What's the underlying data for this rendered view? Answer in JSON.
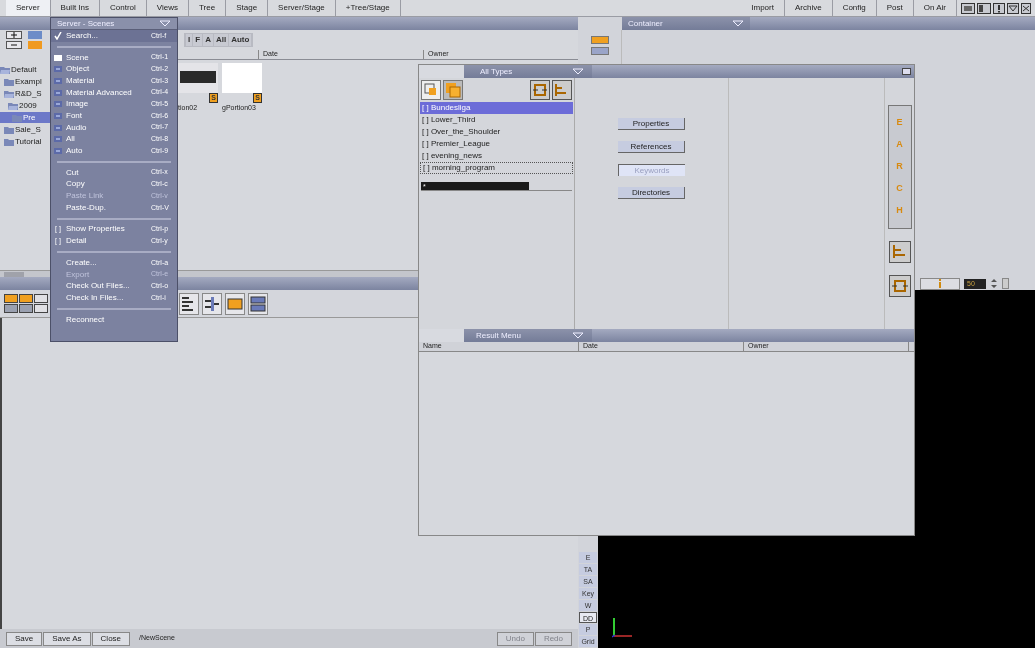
{
  "menubar": {
    "left": [
      {
        "label": "Server",
        "selected": true
      },
      {
        "label": "Built Ins",
        "selected": false
      },
      {
        "label": "Control",
        "selected": false
      },
      {
        "label": "Views",
        "selected": false
      },
      {
        "label": "Tree",
        "selected": false
      },
      {
        "label": "Stage",
        "selected": false
      },
      {
        "label": "Server/Stage",
        "selected": false
      },
      {
        "label": "+Tree/Stage",
        "selected": false
      }
    ],
    "right": [
      {
        "label": "Import",
        "selected": false
      },
      {
        "label": "Archive",
        "selected": false
      },
      {
        "label": "Config",
        "selected": false
      },
      {
        "label": "Post",
        "selected": false
      },
      {
        "label": "On Air",
        "selected": false
      }
    ]
  },
  "scene_pool": {
    "filters": [
      "I",
      "F",
      "A",
      "All",
      "Auto"
    ],
    "columns": [
      "Date",
      "Owner"
    ],
    "tree": [
      {
        "label": "Default",
        "expanded": true,
        "selected": false,
        "children": [
          {
            "label": "Exampl",
            "expanded": false,
            "selected": false
          },
          {
            "label": "R&D_S",
            "expanded": true,
            "selected": false,
            "children": [
              {
                "label": "2009",
                "expanded": true,
                "selected": false,
                "children": [
                  {
                    "label": "Pre",
                    "expanded": false,
                    "selected": true
                  }
                ]
              }
            ]
          },
          {
            "label": "Sale_S",
            "expanded": false,
            "selected": false
          },
          {
            "label": "Tutorial",
            "expanded": false,
            "selected": false
          }
        ]
      }
    ],
    "thumbnails": [
      {
        "name": "tion02",
        "badge": "S",
        "kind": "dark"
      },
      {
        "name": "gPortion03",
        "badge": "S",
        "kind": "blank"
      }
    ]
  },
  "server_menu": {
    "title": "Server - Scenes",
    "sections": [
      [
        {
          "kind": "check",
          "label": "Search...",
          "shortcut": "Ctrl-f",
          "checked": true,
          "disabled": false
        }
      ],
      [
        {
          "kind": "type",
          "label": "Scene",
          "shortcut": "Ctrl-1",
          "checked": true,
          "disabled": false
        },
        {
          "kind": "type",
          "label": "Object",
          "shortcut": "Ctrl-2",
          "checked": false,
          "disabled": false
        },
        {
          "kind": "type",
          "label": "Material",
          "shortcut": "Ctrl-3",
          "checked": false,
          "disabled": false
        },
        {
          "kind": "type",
          "label": "Material Advanced",
          "shortcut": "Ctrl-4",
          "checked": false,
          "disabled": false
        },
        {
          "kind": "type",
          "label": "Image",
          "shortcut": "Ctrl-5",
          "checked": false,
          "disabled": false
        },
        {
          "kind": "type",
          "label": "Font",
          "shortcut": "Ctrl-6",
          "checked": false,
          "disabled": false
        },
        {
          "kind": "type",
          "label": "Audio",
          "shortcut": "Ctrl-7",
          "checked": false,
          "disabled": false
        },
        {
          "kind": "type",
          "label": "All",
          "shortcut": "Ctrl-8",
          "checked": false,
          "disabled": false
        },
        {
          "kind": "type",
          "label": "Auto",
          "shortcut": "Ctrl-9",
          "checked": false,
          "disabled": false
        }
      ],
      [
        {
          "kind": "plain",
          "label": "Cut",
          "shortcut": "Ctrl-x",
          "disabled": false
        },
        {
          "kind": "plain",
          "label": "Copy",
          "shortcut": "Ctrl-c",
          "disabled": false
        },
        {
          "kind": "plain",
          "label": "Paste Link",
          "shortcut": "Ctrl-v",
          "disabled": true
        },
        {
          "kind": "plain",
          "label": "Paste-Dup.",
          "shortcut": "Ctrl-V",
          "disabled": false
        }
      ],
      [
        {
          "kind": "toggle",
          "marker": "[ ]",
          "label": "Show Properties",
          "shortcut": "Ctrl-p",
          "disabled": false
        },
        {
          "kind": "toggle",
          "marker": "[ ]",
          "label": "Detail",
          "shortcut": "Ctrl-y",
          "disabled": false
        }
      ],
      [
        {
          "kind": "plain",
          "label": "Create...",
          "shortcut": "Ctrl-a",
          "disabled": false
        },
        {
          "kind": "plain",
          "label": "Export",
          "shortcut": "Ctrl-e",
          "disabled": true
        },
        {
          "kind": "plain",
          "label": "Check Out Files...",
          "shortcut": "Ctrl-o",
          "disabled": false
        },
        {
          "kind": "plain",
          "label": "Check In Files...",
          "shortcut": "Ctrl-i",
          "disabled": false
        }
      ],
      [
        {
          "kind": "plain",
          "label": "Reconnect",
          "disabled": false
        }
      ]
    ]
  },
  "container": {
    "title": "Container"
  },
  "search_window": {
    "title": "All Types",
    "keywords": [
      {
        "label": "[ ] Bundesliga",
        "selected": true,
        "focused": false
      },
      {
        "label": "[ ] Lower_Third",
        "selected": false,
        "focused": false
      },
      {
        "label": "[ ] Over_the_Shoulder",
        "selected": false,
        "focused": false
      },
      {
        "label": "[ ] Premier_League",
        "selected": false,
        "focused": false
      },
      {
        "label": "[ ] evening_news",
        "selected": false,
        "focused": false
      },
      {
        "label": "[ ] morning_program",
        "selected": false,
        "focused": true
      }
    ],
    "search_value": "*",
    "buttons": [
      {
        "label": "Properties",
        "selected": false
      },
      {
        "label": "References",
        "selected": false
      },
      {
        "label": "Keywords",
        "selected": true
      },
      {
        "label": "Directories",
        "selected": false
      }
    ],
    "banner_letters": [
      "E",
      "A",
      "R",
      "C",
      "H"
    ],
    "result_title": "Result Menu",
    "result_columns": [
      "Name",
      "Date",
      "Owner"
    ]
  },
  "preview": {
    "value": "50",
    "tools": [
      {
        "label": "E",
        "selected": false
      },
      {
        "label": "TA",
        "selected": false
      },
      {
        "label": "SA",
        "selected": false
      },
      {
        "label": "Key",
        "selected": false
      },
      {
        "label": "W",
        "selected": false
      },
      {
        "label": "DD",
        "selected": true
      },
      {
        "label": "P",
        "selected": false
      },
      {
        "label": "Grid",
        "selected": false
      }
    ]
  },
  "bottom_bar": {
    "buttons": [
      {
        "label": "Save",
        "disabled": false
      },
      {
        "label": "Save As",
        "disabled": false
      },
      {
        "label": "Close",
        "disabled": false
      }
    ],
    "scene_path": "/NewScene",
    "history": [
      {
        "label": "Undo",
        "disabled": true
      },
      {
        "label": "Redo",
        "disabled": true
      }
    ]
  }
}
